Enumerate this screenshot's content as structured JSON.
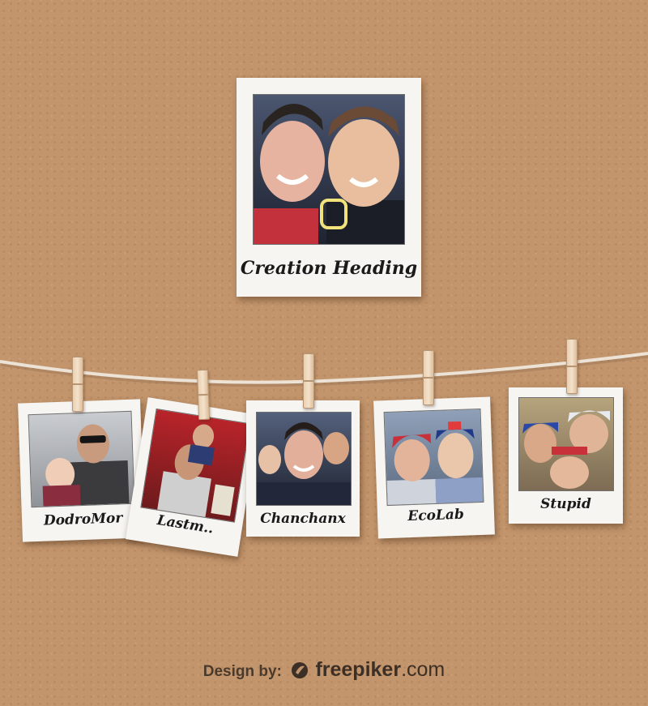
{
  "hero": {
    "caption": "Creation Heading"
  },
  "photos": [
    {
      "caption": "DodroMor"
    },
    {
      "caption": "Lastm.."
    },
    {
      "caption": "Chanchanx"
    },
    {
      "caption": "EcoLab"
    },
    {
      "caption": "Stupid"
    }
  ],
  "footer": {
    "design_by": "Design by:",
    "brand": "freepiker",
    "tld": ".com"
  },
  "colors": {
    "background": "#c3956c",
    "paper": "#f6f5f2",
    "rope": "#ece3d6"
  }
}
